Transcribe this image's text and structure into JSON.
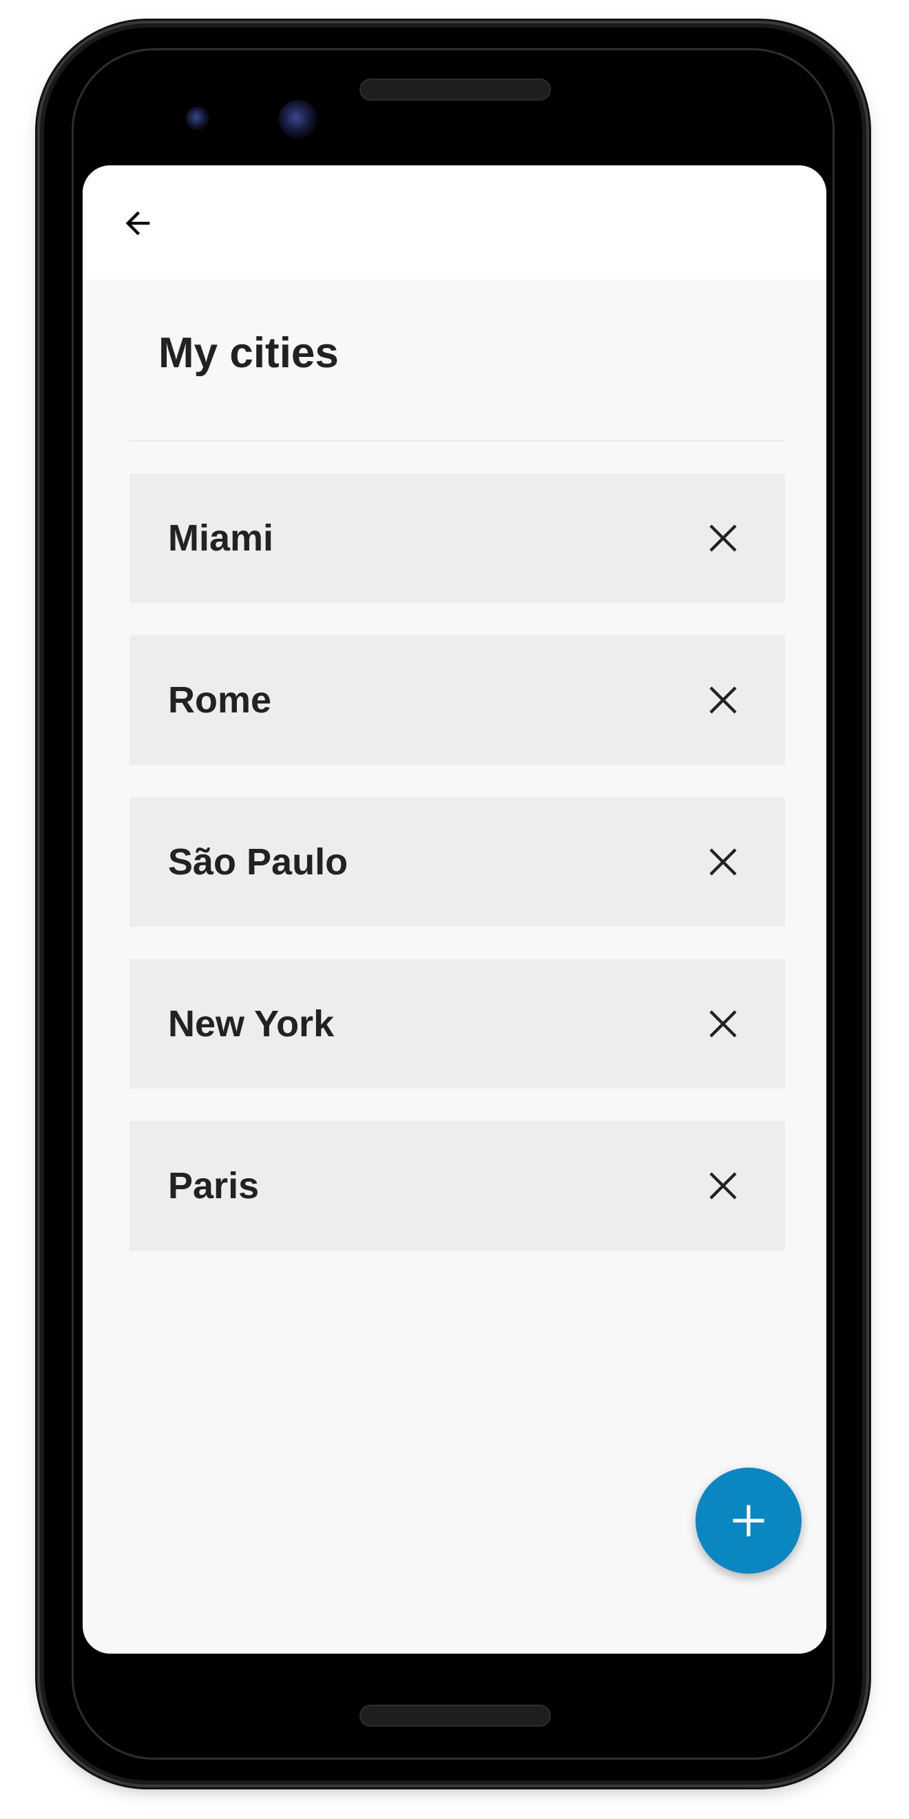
{
  "header": {
    "back_icon": "arrow-left-icon"
  },
  "page": {
    "title": "My cities"
  },
  "cities": [
    {
      "name": "Miami",
      "remove_icon": "close-icon"
    },
    {
      "name": "Rome",
      "remove_icon": "close-icon"
    },
    {
      "name": "São Paulo",
      "remove_icon": "close-icon"
    },
    {
      "name": "New York",
      "remove_icon": "close-icon"
    },
    {
      "name": "Paris",
      "remove_icon": "close-icon"
    }
  ],
  "fab": {
    "icon": "plus-icon",
    "color": "#0a86c0"
  },
  "colors": {
    "background": "#f8f8f8",
    "app_bar": "#ffffff",
    "list_item": "#ededed",
    "text": "#222222"
  }
}
